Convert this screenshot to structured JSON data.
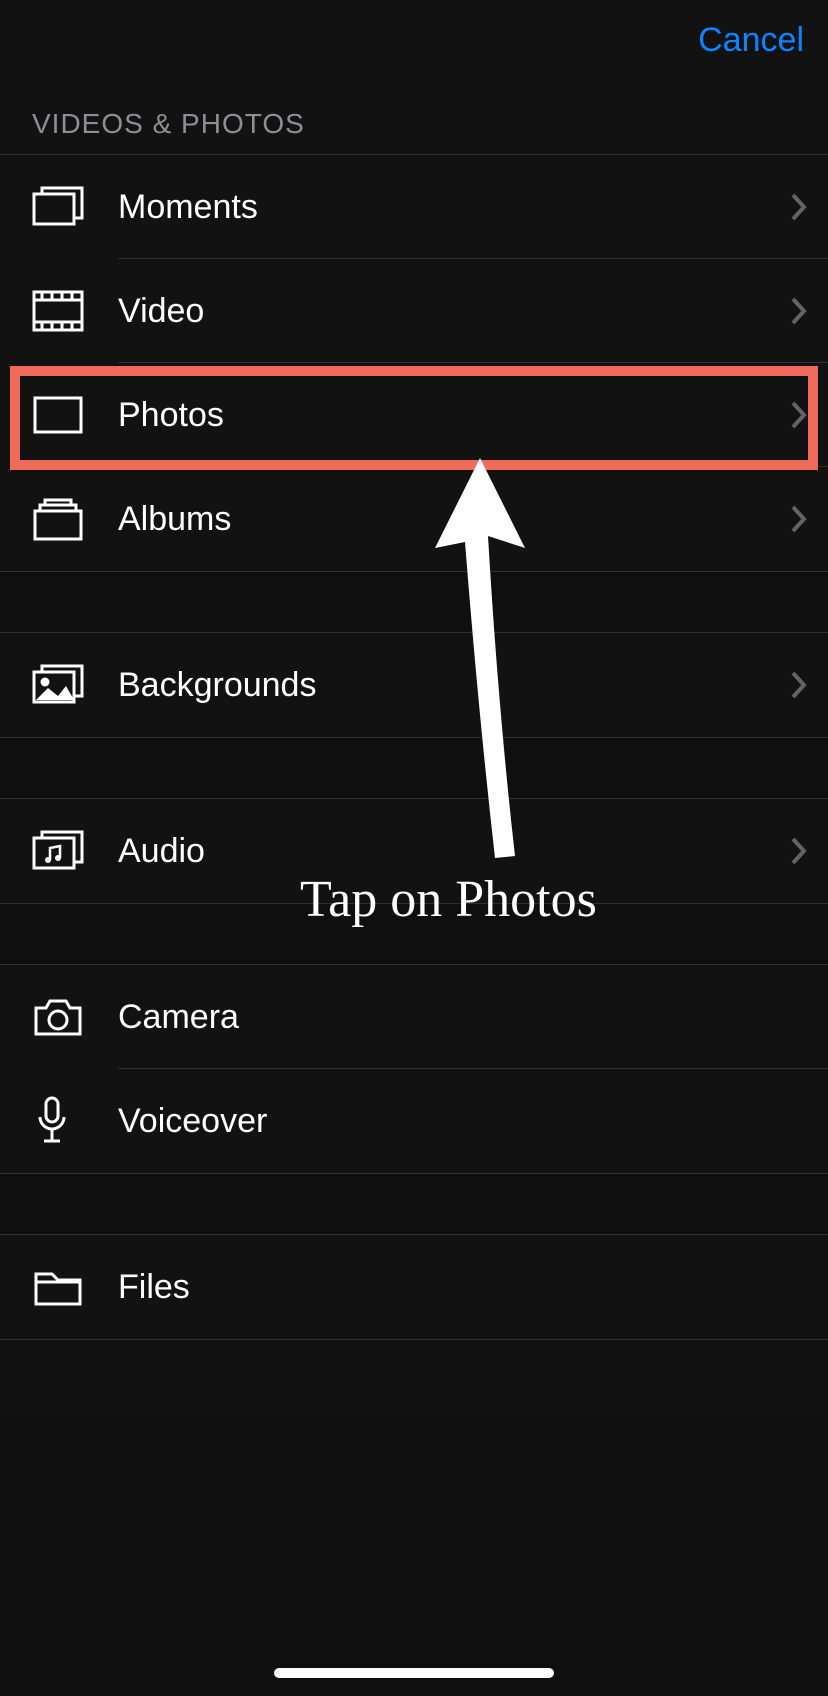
{
  "topbar": {
    "cancel": "Cancel"
  },
  "section_header": "Videos & Photos",
  "rows": {
    "moments": "Moments",
    "video": "Video",
    "photos": "Photos",
    "albums": "Albums",
    "backgrounds": "Backgrounds",
    "audio": "Audio",
    "camera": "Camera",
    "voiceover": "Voiceover",
    "files": "Files"
  },
  "annotation": {
    "text": "Tap on Photos"
  }
}
